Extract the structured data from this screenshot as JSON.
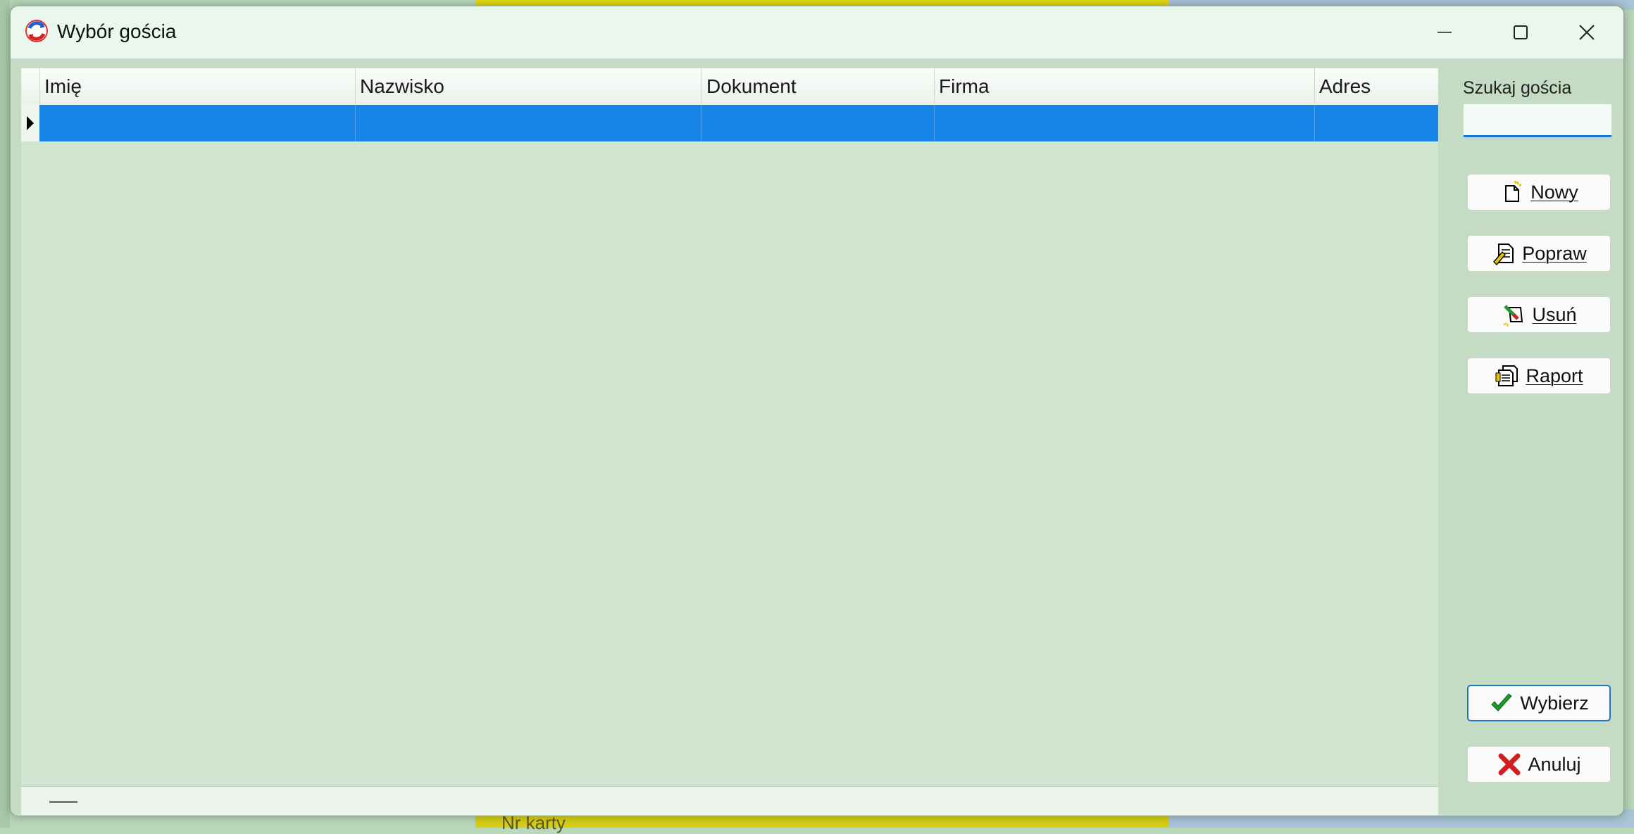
{
  "window": {
    "title": "Wybór gościa"
  },
  "background": {
    "label": "Nr karty"
  },
  "grid": {
    "columns": [
      "Imię",
      "Nazwisko",
      "Dokument",
      "Firma",
      "Adres"
    ],
    "rows": []
  },
  "search": {
    "label": "Szukaj gościa",
    "value": "",
    "placeholder": ""
  },
  "buttons": {
    "new": "Nowy",
    "edit": "Popraw",
    "delete": "Usuń",
    "report": "Raport",
    "select": "Wybierz",
    "cancel": "Anuluj"
  },
  "colors": {
    "selection": "#1584e6",
    "grid_bg": "#d0e6d0",
    "panel_bg": "#c3dcc3",
    "accent": "#1f76c4"
  },
  "icons": {
    "app": "app-icon",
    "new": "new-document-icon",
    "edit": "edit-document-icon",
    "delete": "delete-icon",
    "report": "report-icon",
    "select": "checkmark-icon",
    "cancel": "cross-icon"
  }
}
